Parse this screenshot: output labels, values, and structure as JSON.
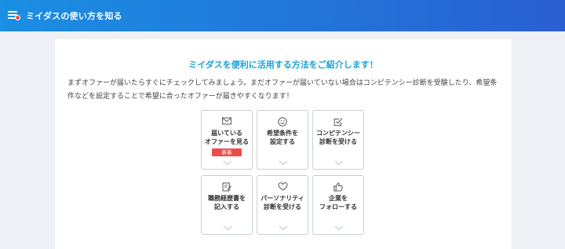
{
  "header": {
    "title": "ミイダスの使い方を知る"
  },
  "main": {
    "headline": "ミイダスを便利に活用する方法をご紹介します！",
    "lead": "まずオファーが届いたらすぐにチェックしてみましょう。まだオファーが届いていない場合はコンピテンシー診断を受験したり、希望条件などを設定することで希望に合ったオファーが届きやすくなります！",
    "tiles": [
      {
        "label": "届いている\nオファーを見る",
        "icon": "mail-icon",
        "badge": "新着"
      },
      {
        "label": "希望条件を\n設定する",
        "icon": "smiley-icon"
      },
      {
        "label": "コンピテンシー\n診断を受ける",
        "icon": "checkbox-icon"
      },
      {
        "label": "職務経歴書を\n記入する",
        "icon": "edit-document-icon"
      },
      {
        "label": "パーソナリティ\n診断を受ける",
        "icon": "heart-icon"
      },
      {
        "label": "企業を\nフォローする",
        "icon": "thumbs-up-icon"
      }
    ]
  },
  "colors": {
    "header_start": "#1a8fe3",
    "header_end": "#2a5fd1",
    "accent": "#19a3d8",
    "badge": "#f04b4b"
  }
}
